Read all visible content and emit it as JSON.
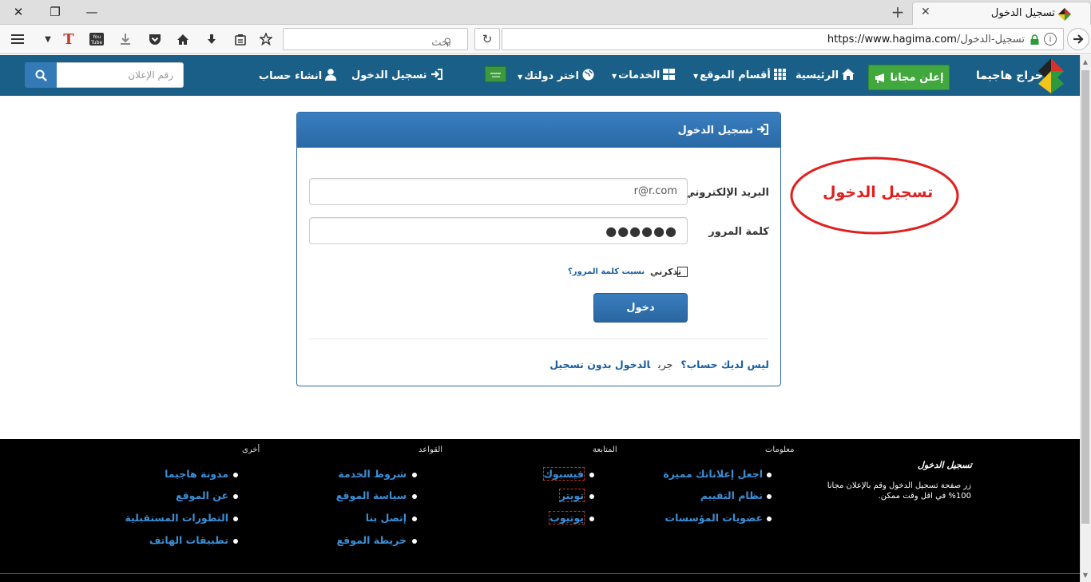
{
  "browser": {
    "tab_title": "تسجيل الدخول",
    "search_placeholder": "بحث",
    "url_domain": "https://www.hagima.com",
    "url_path": "/تسجيل-الدخول",
    "window_buttons": [
      "✕",
      "❐",
      "—"
    ]
  },
  "site_header": {
    "logo_text": "حراج هاجيما",
    "post_ad_label": "إعلن مجانا",
    "nav": {
      "home": "الرئيسية",
      "sections": "أقسام الموقع",
      "services": "الخدمات",
      "country": "اختر دولتك",
      "login": "تسجيل الدخول",
      "register": "انشاء حساب"
    },
    "ad_number_placeholder": "رقم الإعلان"
  },
  "login_panel": {
    "title": "تسجيل الدخول",
    "email_label": "البريد الإلكتروني",
    "email_value": "r@r.com",
    "password_label": "كلمة المرور",
    "password_value": "●●●●●●",
    "remember_label": "تذكرني",
    "forgot_label": "نسيت كلمة المرور؟",
    "submit_label": "دخول",
    "no_account_label": "ليس لديك حساب؟",
    "try_label": "جرب",
    "guest_login_label": "الدخول بدون تسجيل"
  },
  "annotation": {
    "text": "تسجيل الدخول",
    "color": "#e0201e"
  },
  "footer": {
    "about_title": "تسجيل الدخول",
    "about_text": "زر صفحة تسجيل الدخول وقم بالإعلان مجانا 100% في اقل وقت ممكن.",
    "columns": [
      {
        "heading": "معلومات",
        "items": [
          "اجعل إعلاناتك مميزة",
          "نظام التقييم",
          "عضويات المؤسسات"
        ]
      },
      {
        "heading": "المتابعة",
        "items": [
          "فيسبوك",
          "تويتر",
          "يوتيوب"
        ]
      },
      {
        "heading": "القواعد",
        "items": [
          "شروط الخدمة",
          "سياسة الموقع",
          "إتصل بنا",
          "خريطة الموقع"
        ]
      },
      {
        "heading": "أخرى",
        "items": [
          "مدونة هاجيما",
          "عن الموقع",
          "التطورات المستقبلية",
          "تطبيقات الهاتف"
        ]
      }
    ]
  },
  "colors": {
    "header_bg": "#1a5f87",
    "post_ad_green": "#41a83e",
    "panel_blue": "#2e6da4",
    "link_blue": "#1a5f9f",
    "footer_bg": "#000000"
  }
}
